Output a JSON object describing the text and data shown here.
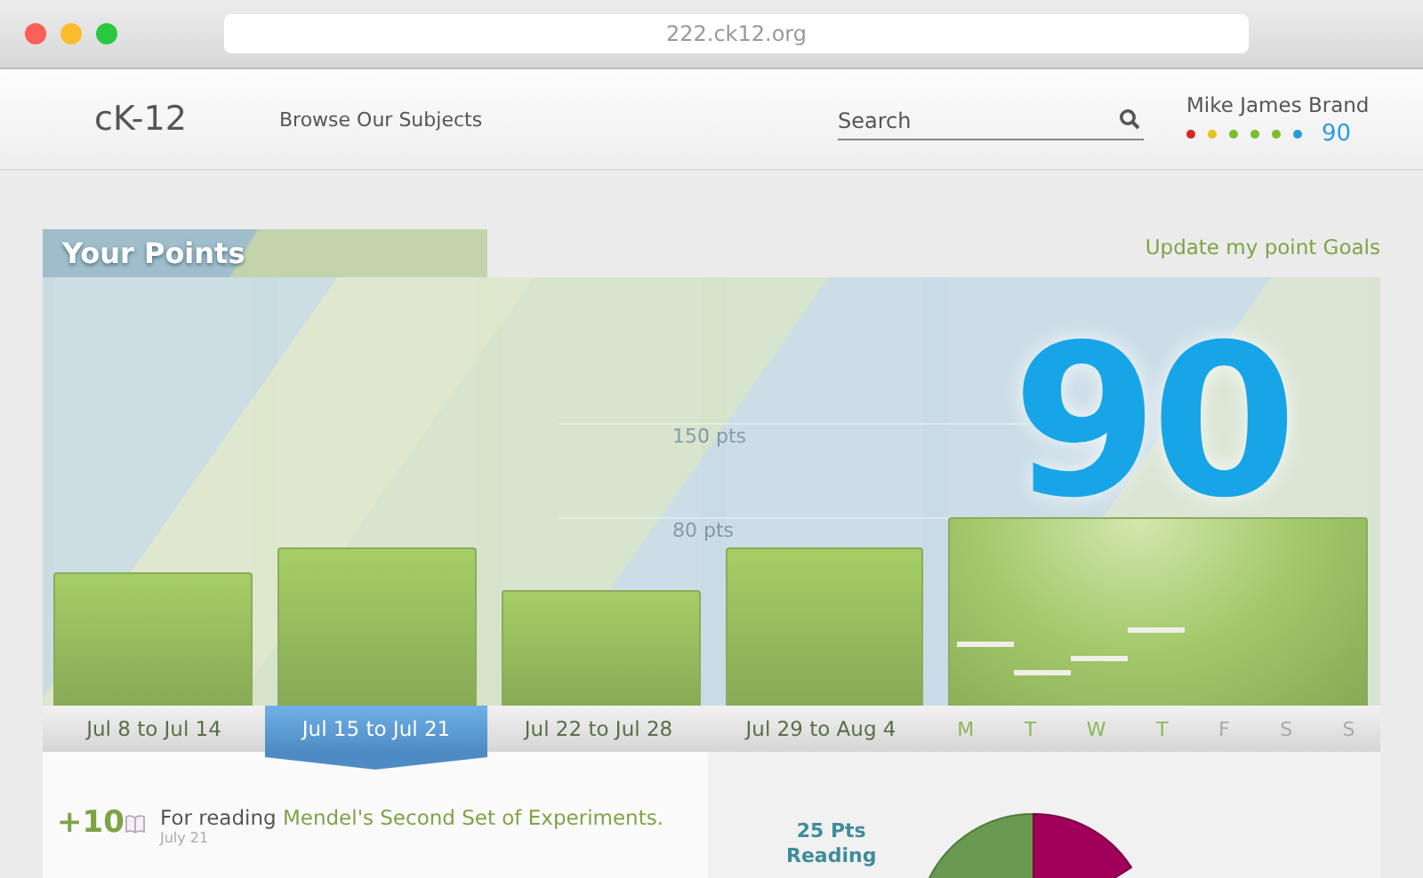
{
  "browser": {
    "url": "222.ck12.org"
  },
  "header": {
    "logo": "cK-12",
    "nav": "Browse Our Subjects",
    "search": {
      "placeholder": "Search"
    },
    "user": {
      "name": "Mike James Brand",
      "points": "90",
      "dots": [
        {
          "color": "#d42a22"
        },
        {
          "color": "#e6c419"
        },
        {
          "color": "#7bbf2a"
        },
        {
          "color": "#7bbf2a"
        },
        {
          "color": "#7bbf2a"
        },
        {
          "color": "#2a9be0"
        }
      ]
    }
  },
  "points": {
    "title": "Your Points",
    "goal_link": "Update my point Goals",
    "total": "90",
    "gridlines": [
      "150 pts",
      "80 pts"
    ],
    "weeks": [
      {
        "label": "Jul 8 to Jul 14",
        "level": 0.31,
        "selected": false
      },
      {
        "label": "Jul 15 to Jul 21",
        "level": 0.37,
        "selected": true
      },
      {
        "label": "Jul 22 to Jul 28",
        "level": 0.27,
        "selected": false
      },
      {
        "label": "Jul 29 to Aug 4",
        "level": 0.37,
        "selected": false
      }
    ],
    "current_week": {
      "level": 0.44,
      "days": [
        {
          "label": "M",
          "active": true
        },
        {
          "label": "T",
          "active": true
        },
        {
          "label": "W",
          "active": true
        },
        {
          "label": "T",
          "active": true
        },
        {
          "label": "F",
          "active": false
        },
        {
          "label": "S",
          "active": false
        },
        {
          "label": "S",
          "active": false
        }
      ]
    }
  },
  "activity": [
    {
      "points": "+10",
      "text": "For reading",
      "link": "Mendel's Second Set of Experiments.",
      "date": "July 21"
    }
  ],
  "breakdown": {
    "label": "25 Pts",
    "category": "Reading"
  }
}
